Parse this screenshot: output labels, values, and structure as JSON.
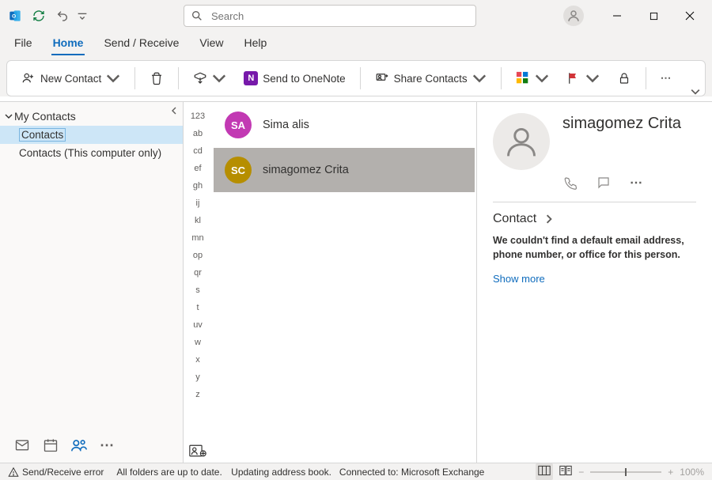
{
  "titlebar": {
    "search_placeholder": "Search"
  },
  "menus": {
    "file": "File",
    "home": "Home",
    "sendreceive": "Send / Receive",
    "view": "View",
    "help": "Help"
  },
  "ribbon": {
    "new_contact": "New Contact",
    "send_onenote": "Send to OneNote",
    "share_contacts": "Share Contacts"
  },
  "nav": {
    "header": "My Contacts",
    "items": [
      {
        "label": "Contacts",
        "selected": true
      },
      {
        "label": "Contacts (This computer only)",
        "selected": false
      }
    ]
  },
  "alpha_index": [
    "123",
    "ab",
    "cd",
    "ef",
    "gh",
    "ij",
    "kl",
    "mn",
    "op",
    "qr",
    "s",
    "t",
    "uv",
    "w",
    "x",
    "y",
    "z"
  ],
  "contacts": [
    {
      "initials": "SA",
      "name": "Sima alis",
      "color": "#c239b3",
      "selected": false
    },
    {
      "initials": "SC",
      "name": "simagomez Crita",
      "color": "#b68e00",
      "selected": true
    }
  ],
  "detail": {
    "name": "simagomez Crita",
    "section": "Contact",
    "message": "We couldn't find a default email address, phone number, or office for this person.",
    "show_more": "Show more"
  },
  "status": {
    "error": "Send/Receive error",
    "folders": "All folders are up to date.",
    "updating": "Updating address book.",
    "connected": "Connected to: Microsoft Exchange",
    "zoom": "100%"
  }
}
